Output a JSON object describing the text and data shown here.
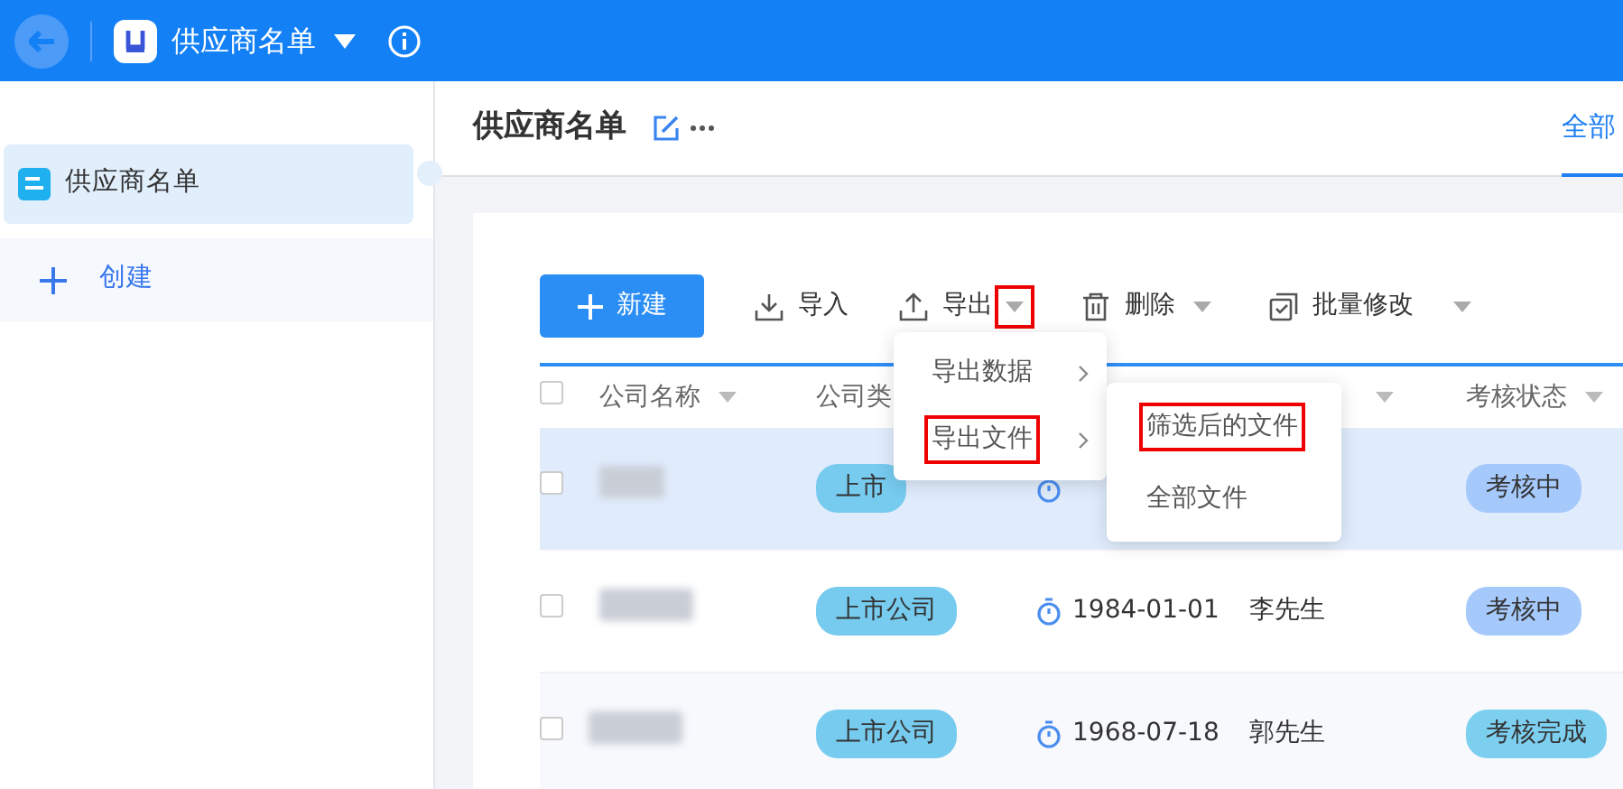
{
  "app_bar": {
    "title": "供应商名单"
  },
  "sidebar": {
    "items": [
      {
        "label": "供应商名单",
        "selected": true
      }
    ],
    "create_label": "创建"
  },
  "page": {
    "title": "供应商名单",
    "tabs": [
      {
        "label": "全部",
        "selected": true
      }
    ]
  },
  "toolbar": [
    {
      "kind": "primary",
      "label": "新建"
    },
    {
      "kind": "action",
      "label": "导入"
    },
    {
      "kind": "action",
      "label": "导出",
      "caret": true,
      "highlighted": true
    },
    {
      "kind": "action",
      "label": "删除",
      "caret": true,
      "highlighted": false
    },
    {
      "kind": "action",
      "label": "批量修改",
      "caret": true,
      "highlighted": false
    }
  ],
  "table": {
    "all_checked": false,
    "columns": [
      {
        "label": "公司名称",
        "sortable": true
      },
      {
        "label": "公司类",
        "sortable": false
      },
      {
        "sortable": true
      },
      {
        "label": "考核状态",
        "sortable": true
      }
    ],
    "rows": [
      {
        "selected": true,
        "checked": false,
        "type": "上市",
        "status": {
          "label": "考核中",
          "color": "#a6c9fb"
        }
      },
      {
        "selected": false,
        "checked": false,
        "type": "上市公司",
        "date": "1984-01-01",
        "contact": "李先生",
        "status": {
          "label": "考核中",
          "color": "#a6c9fb"
        }
      },
      {
        "selected": false,
        "checked": false,
        "type": "上市公司",
        "date": "1968-07-18",
        "contact": "郭先生",
        "status": {
          "label": "考核完成",
          "color": "#7dcff0"
        }
      }
    ]
  },
  "menu": {
    "items": [
      {
        "label": "导出数据",
        "highlighted": false
      },
      {
        "label": "导出文件",
        "highlighted": true
      }
    ],
    "submenu": [
      {
        "label": "筛选后的文件",
        "highlighted": true
      },
      {
        "label": "全部文件",
        "highlighted": false
      }
    ]
  }
}
